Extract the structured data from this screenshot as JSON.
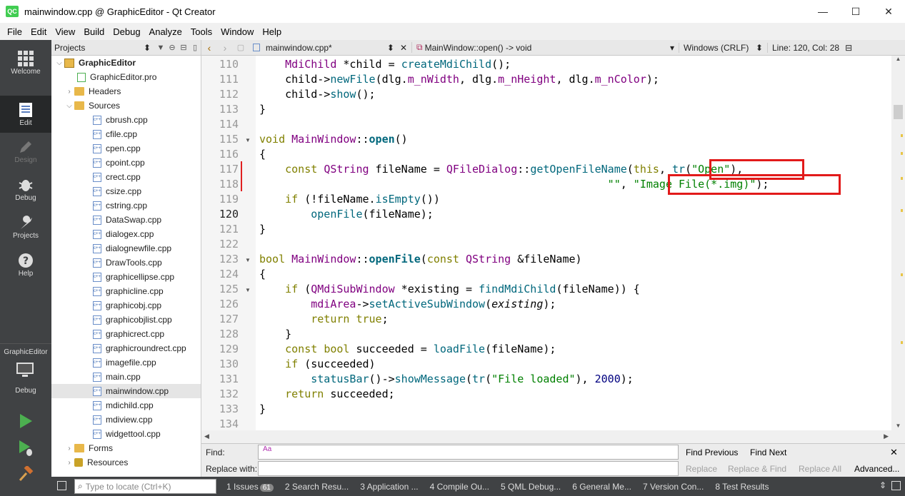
{
  "window": {
    "title": "mainwindow.cpp @ GraphicEditor - Qt Creator",
    "logo": "QC",
    "minimize": "—",
    "maximize": "☐",
    "close": "✕"
  },
  "menu": [
    "File",
    "Edit",
    "View",
    "Build",
    "Debug",
    "Analyze",
    "Tools",
    "Window",
    "Help"
  ],
  "modes": [
    {
      "id": "welcome",
      "label": "Welcome",
      "icon": "grid-icon"
    },
    {
      "id": "edit",
      "label": "Edit",
      "icon": "document-icon",
      "active": true
    },
    {
      "id": "design",
      "label": "Design",
      "icon": "pen-icon",
      "disabled": true
    },
    {
      "id": "debug",
      "label": "Debug",
      "icon": "bug-icon"
    },
    {
      "id": "projects",
      "label": "Projects",
      "icon": "wrench-icon"
    },
    {
      "id": "help",
      "label": "Help",
      "icon": "help-icon"
    }
  ],
  "kit": {
    "project": "GraphicEditor",
    "config": "Debug"
  },
  "project_panel": {
    "selector": "Projects"
  },
  "tree": {
    "root": "GraphicEditor",
    "pro": "GraphicEditor.pro",
    "headers": "Headers",
    "sources": "Sources",
    "files": [
      "cbrush.cpp",
      "cfile.cpp",
      "cpen.cpp",
      "cpoint.cpp",
      "crect.cpp",
      "csize.cpp",
      "cstring.cpp",
      "DataSwap.cpp",
      "dialogex.cpp",
      "dialognewfile.cpp",
      "DrawTools.cpp",
      "graphicellipse.cpp",
      "graphicline.cpp",
      "graphicobj.cpp",
      "graphicobjlist.cpp",
      "graphicrect.cpp",
      "graphicroundrect.cpp",
      "imagefile.cpp",
      "main.cpp",
      "mainwindow.cpp",
      "mdichild.cpp",
      "mdiview.cpp",
      "widgettool.cpp"
    ],
    "selected_file": "mainwindow.cpp",
    "forms": "Forms",
    "resources": "Resources"
  },
  "editor": {
    "document": "mainwindow.cpp*",
    "function": "MainWindow::open() -> void",
    "encoding": "Windows (CRLF)",
    "position": "Line: 120, Col: 28",
    "current_line": 120,
    "line_numbers": [
      "110",
      "111",
      "112",
      "113",
      "114",
      "115",
      "116",
      "117",
      "118",
      "119",
      "120",
      "121",
      "122",
      "123",
      "124",
      "125",
      "126",
      "127",
      "128",
      "129",
      "130",
      "131",
      "132",
      "133",
      "134"
    ]
  },
  "find": {
    "find_label": "Find:",
    "replace_label": "Replace with:",
    "find_value": "Aa",
    "find_previous": "Find Previous",
    "find_next": "Find Next",
    "replace": "Replace",
    "replace_find": "Replace & Find",
    "replace_all": "Replace All",
    "advanced": "Advanced..."
  },
  "statusbar": {
    "locate_placeholder": "Type to locate (Ctrl+K)",
    "tabs": [
      {
        "label": "1 Issues",
        "badge": "61"
      },
      {
        "label": "2 Search Resu..."
      },
      {
        "label": "3 Application ..."
      },
      {
        "label": "4 Compile Ou..."
      },
      {
        "label": "5 QML Debug..."
      },
      {
        "label": "6 General Me..."
      },
      {
        "label": "7 Version Con..."
      },
      {
        "label": "8 Test Results"
      }
    ]
  },
  "colors": {
    "mode_bar": "#404244",
    "keyword": "#808000",
    "type": "#800080",
    "function": "#00677c",
    "string": "#008000",
    "highlight_box": "#e21a1a"
  }
}
